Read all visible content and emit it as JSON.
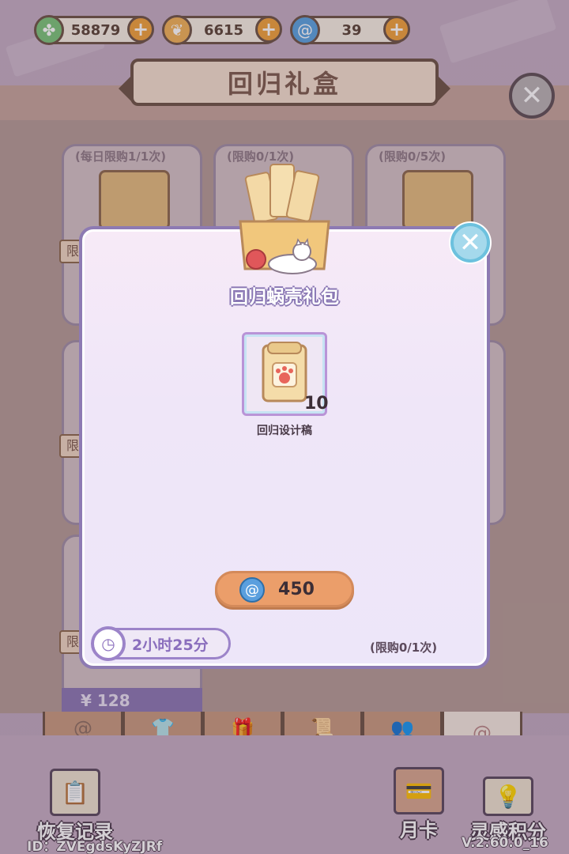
{
  "currencies": [
    {
      "icon": "clover-icon",
      "value": "58879",
      "color": "#7cc47a"
    },
    {
      "icon": "nut-icon",
      "value": "6615",
      "color": "#f1b258"
    },
    {
      "icon": "swirl-shell-icon",
      "value": "39",
      "color": "#5aa3e0"
    }
  ],
  "header": {
    "title": "回归礼盒"
  },
  "shop_cards": [
    {
      "limit": "(每日限购1/1次)"
    },
    {
      "limit": "(限购0/1次)"
    },
    {
      "limit": "(限购0/5次)"
    }
  ],
  "shop_tags": [
    "限",
    "限",
    "限"
  ],
  "price_tab": "¥ 128",
  "modal": {
    "title": "回归蜗壳礼包",
    "item": {
      "name": "回归设计稿",
      "count": "10"
    },
    "buy_price": "450",
    "timer": "2小时25分",
    "limit": "(限购0/1次)"
  },
  "tabs": [
    "swirl-icon",
    "shirt-icon",
    "gift-icon",
    "scroll-icon",
    "people-icon",
    "swirl-icon"
  ],
  "bottom": {
    "restore_label": "恢复记录",
    "month_card_label": "月卡",
    "inspiration_label": "灵感积分",
    "user_id": "ID：ZVEgdsKyZJRf",
    "version": "V.2.60.0_16"
  },
  "colors": {
    "accent": "#8d7ab3",
    "buy": "#eb9e6a",
    "brown": "#6e5446"
  }
}
